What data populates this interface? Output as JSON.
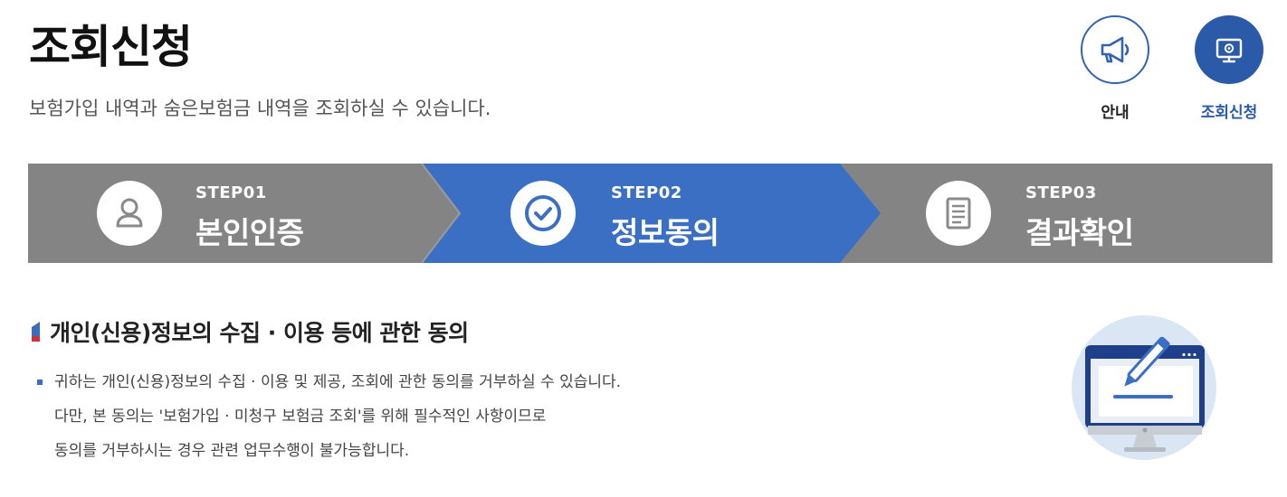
{
  "header": {
    "title": "조회신청",
    "subtitle": "보험가입 내역과 숨은보험금 내역을 조회하실 수 있습니다."
  },
  "quick_menu": [
    {
      "label": "안내",
      "icon": "megaphone-icon",
      "active": false
    },
    {
      "label": "조회신청",
      "icon": "monitor-search-icon",
      "active": true
    }
  ],
  "steps": [
    {
      "num": "STEP01",
      "name": "본인인증",
      "icon": "person-icon",
      "active": false
    },
    {
      "num": "STEP02",
      "name": "정보동의",
      "icon": "check-circle-icon",
      "active": true
    },
    {
      "num": "STEP03",
      "name": "결과확인",
      "icon": "document-icon",
      "active": false
    }
  ],
  "section": {
    "title": "개인(신용)정보의 수집 · 이용 등에 관한 동의",
    "notice_lines": [
      "귀하는 개인(신용)정보의 수집 · 이용 및 제공, 조회에 관한 동의를 거부하실 수 있습니다.",
      "다만, 본 동의는 '보험가입 · 미청구 보험금 조회'를 위해 필수적인 사항이므로",
      "동의를 거부하시는 경우 관련 업무수행이 불가능합니다."
    ]
  },
  "colors": {
    "primary": "#3a6fc4",
    "step_inactive": "#848484",
    "quick_active": "#2a5aa8",
    "title_mark_blue": "#3b6cc0",
    "title_mark_red": "#d0303a"
  }
}
